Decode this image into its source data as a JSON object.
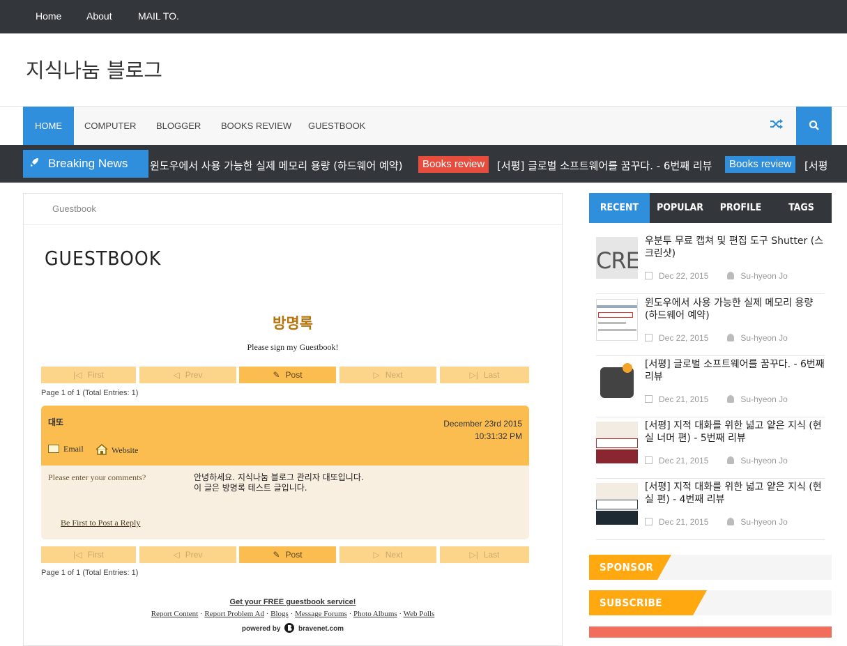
{
  "topnav": {
    "items": [
      "Home",
      "About",
      "MAIL TO."
    ]
  },
  "site_title": "지식나눔 블로그",
  "mainnav": {
    "items": [
      "HOME",
      "COMPUTER",
      "BLOGGER",
      "BOOKS REVIEW",
      "GUESTBOOK"
    ]
  },
  "ticker": {
    "label": "Breaking News",
    "item1": "윈도우에서 사용 가능한 실제 메모리 용량 (하드웨어 예약)",
    "tag1": "Books review",
    "item2": "[서평] 글로벌 소프트웨어를 꿈꾸다. - 6번째 리뷰",
    "tag2": "Books review",
    "item3": "[서평",
    "colors": {
      "tag1": "#e74c3c",
      "tag2": "#2f8fdc"
    }
  },
  "breadcrumb": "Guestbook",
  "page_title": "GUESTBOOK",
  "guestbook": {
    "title": "방명록",
    "subtitle": "Please sign my Guestbook!",
    "pager": {
      "first": "First",
      "prev": "Prev",
      "post": "Post",
      "next": "Next",
      "last": "Last"
    },
    "page_info": "Page 1 of 1 (Total Entries: 1)",
    "entry": {
      "name": "대또",
      "date": "December 23rd 2015",
      "time": "10:31:32 PM",
      "email_label": "Email",
      "website_label": "Website",
      "prompt": "Please enter your comments?",
      "comment_line1": "안녕하세요. 지식나눔 블로그 관리자 대또입니다.",
      "comment_line2": "이 글은 방명록 테스트 글입니다.",
      "reply": "Be First to Post a Reply"
    },
    "promo": "Get your FREE guestbook service!",
    "links": [
      "Report Content",
      "Report Problem Ad",
      "Blogs",
      "Message Forums",
      "Photo Albums",
      "Web Polls"
    ],
    "powered_by": "powered by",
    "brand": "bravenet.com"
  },
  "sidebar": {
    "tabs": [
      "RECENT",
      "POPULAR",
      "PROFILE",
      "TAGS"
    ],
    "posts": [
      {
        "title": "우분투 무료 캡쳐 및 편집 도구 Shutter (스크린샷)",
        "date": "Dec 22, 2015",
        "author": "Su-hyeon Jo",
        "thumb_text": "CRE"
      },
      {
        "title": "윈도우에서 사용 가능한 실제 메모리 용량 (하드웨어 예약)",
        "date": "Dec 22, 2015",
        "author": "Su-hyeon Jo",
        "thumb_text": ""
      },
      {
        "title": "[서평] 글로벌 소프트웨어를 꿈꾸다. - 6번째 리뷰",
        "date": "Dec 21, 2015",
        "author": "Su-hyeon Jo",
        "thumb_text": ""
      },
      {
        "title": "[서평] 지적 대화를 위한 넓고 얕은 지식 (현실 너머 편) - 5번째 리뷰",
        "date": "Dec 21, 2015",
        "author": "Su-hyeon Jo",
        "thumb_text": ""
      },
      {
        "title": "[서평] 지적 대화를 위한 넓고 얕은 지식 (현실 편) - 4번째 리뷰",
        "date": "Dec 21, 2015",
        "author": "Su-hyeon Jo",
        "thumb_text": ""
      }
    ],
    "widgets": [
      "SPONSOR",
      "SUBSCRIBE HERE"
    ]
  }
}
